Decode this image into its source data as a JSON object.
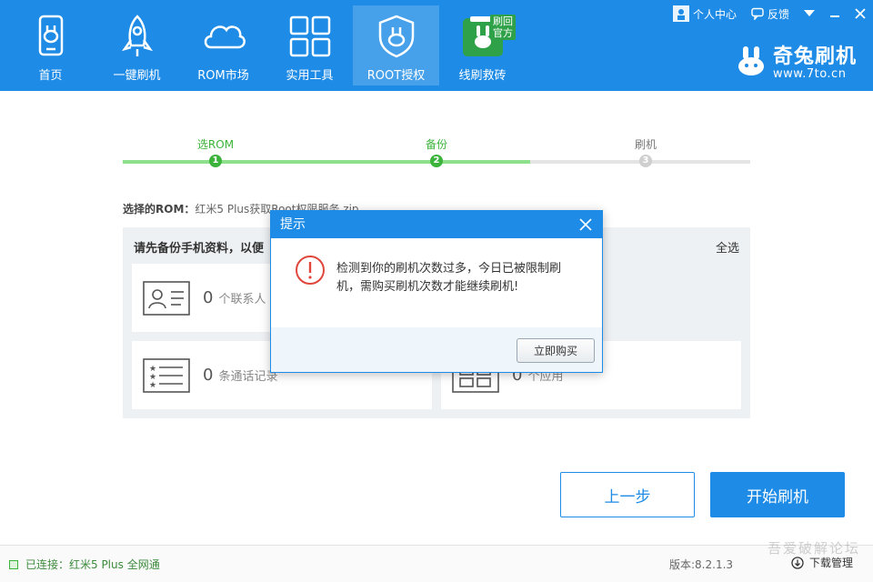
{
  "nav": {
    "items": [
      {
        "label": "首页",
        "icon": "phone-home-icon"
      },
      {
        "label": "一键刷机",
        "icon": "rocket-icon"
      },
      {
        "label": "ROM市场",
        "icon": "cloud-icon"
      },
      {
        "label": "实用工具",
        "icon": "grid-tools-icon"
      },
      {
        "label": "ROOT授权",
        "icon": "shield-rabbit-icon"
      },
      {
        "label": "线刷救砖",
        "icon": "brick-rescue-icon"
      }
    ],
    "active_index": 4,
    "badge": "刷回\n官方"
  },
  "topbar": {
    "user_center": "个人中心",
    "feedback": "反馈"
  },
  "brand": {
    "name": "奇兔刷机",
    "url": "www.7to.cn"
  },
  "steps": [
    {
      "num": "1",
      "label": "选ROM",
      "state": "done"
    },
    {
      "num": "2",
      "label": "备份",
      "state": "current"
    },
    {
      "num": "3",
      "label": "刷机",
      "state": "pending"
    }
  ],
  "rom": {
    "prefix": "选择的ROM：",
    "value": "红米5 Plus获取Root权限服务.zip"
  },
  "backup": {
    "title": "请先备份手机资料，以便",
    "select_all": "全选",
    "cards": [
      {
        "count": "0",
        "label": "个联系人",
        "icon": "contact-card-icon"
      },
      {
        "count": "0",
        "label": "条通话记录",
        "icon": "call-log-icon"
      },
      {
        "count": "0",
        "label": "个应用",
        "icon": "apps-icon"
      }
    ]
  },
  "buttons": {
    "prev": "上一步",
    "start": "开始刷机"
  },
  "status": {
    "connection": "已连接：红米5 Plus 全网通",
    "version": "版本:8.2.1.3",
    "download_manager": "下载管理",
    "watermark": "吾爱破解论坛"
  },
  "modal": {
    "title": "提示",
    "message": "检测到你的刷机次数过多，今日已被限制刷机，需购买刷机次数才能继续刷机!",
    "buy_button": "立即购买"
  },
  "colors": {
    "primary": "#1e8be6",
    "success": "#3cb33a",
    "warning_icon": "#e0463c"
  }
}
